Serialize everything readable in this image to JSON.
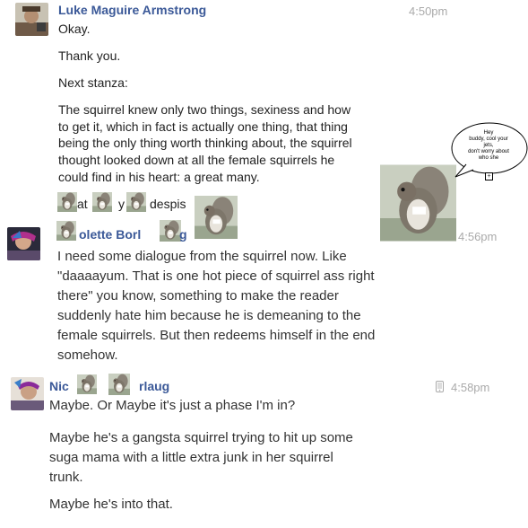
{
  "messages": [
    {
      "sender": "Luke Maguire Armstrong",
      "time": "4:50pm",
      "lines": [
        "Okay.",
        "Thank you.",
        "Next stanza:"
      ],
      "stanza": [
        "The squirrel knew only two things, sexiness and how",
        "to get it, which in fact is actually one thing, that thing",
        "being the only thing worth thinking about, the squirrel",
        "thought looked down at all the female squirrels he",
        "could find in his heart: a great many."
      ],
      "fragments": [
        "at",
        "y",
        "despis"
      ]
    },
    {
      "sender_visible": "olette Borl",
      "sender_tail": "g",
      "time": "4:56pm",
      "lines": [
        "I need some dialogue from the squirrel now. Like",
        "\"daaaayum. That is one hot piece of squirrel ass right",
        "there\" you know, something to make the reader",
        "suddenly hate him because he is demeaning to the",
        "female squirrels. But then redeems himself in the end",
        "somehow."
      ]
    },
    {
      "sender_visible": "Nic",
      "sender_tail": "rlaug",
      "time": "4:58pm",
      "lines": [
        "Maybe. Or Maybe it's just a phase I'm in?",
        "Maybe he's a gangsta squirrel trying to hit up some",
        "suga mama with a little extra junk in her squirrel",
        "trunk.",
        "Maybe he's into that."
      ]
    }
  ],
  "speech_bubble": {
    "lines": [
      "Hey",
      "buddy, cool your",
      "jets,",
      "don't worry about",
      "who she"
    ],
    "plus": "+"
  },
  "colors": {
    "name": "#3b5998",
    "time": "#aaaaaa",
    "text": "#222222"
  }
}
